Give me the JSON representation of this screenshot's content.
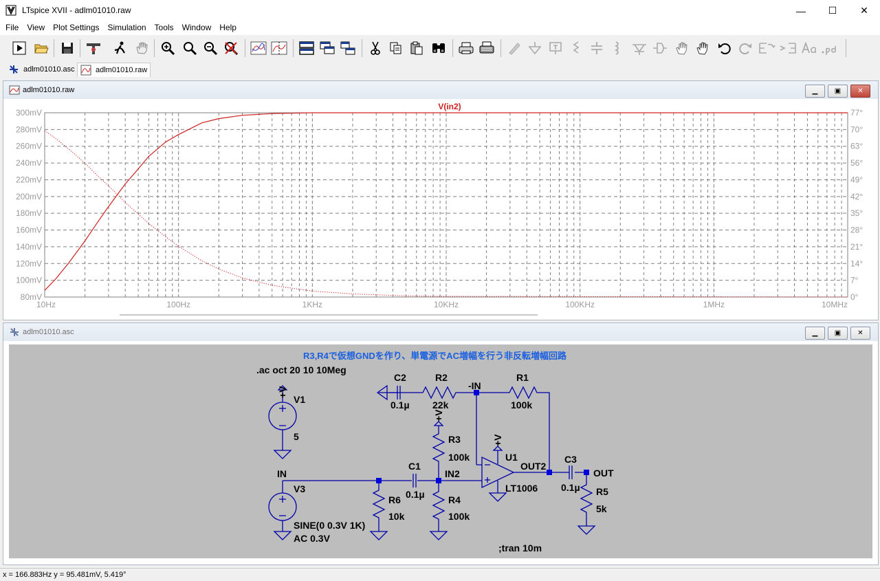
{
  "window": {
    "title": "LTspice XVII - adlm01010.raw",
    "min_label": "—",
    "max_label": "☐",
    "close_label": "✕"
  },
  "menu": {
    "items": [
      "File",
      "View",
      "Plot Settings",
      "Simulation",
      "Tools",
      "Window",
      "Help"
    ]
  },
  "toolbar": {
    "icons": [
      "run-icon",
      "open-icon",
      "save-icon",
      "control-panel-icon",
      "run-animate-icon",
      "pan-hand-icon",
      "zoom-in-icon",
      "zoom-out-icon",
      "zoom-fit-icon",
      "zoom-cancel-icon",
      "autorange-icon",
      "plot-pane-icon",
      "tile-horizontal-icon",
      "cascade-icon",
      "tile-vertical-icon",
      "cut-icon",
      "copy-icon",
      "paste-icon",
      "find-icon",
      "print-icon",
      "print-setup-icon",
      "draw-wire-icon",
      "ground-icon",
      "label-net-icon",
      "resistor-icon",
      "capacitor-icon",
      "inductor-icon",
      "diode-icon",
      "component-icon",
      "move-icon",
      "drag-icon",
      "undo-icon",
      "redo-icon",
      "rotate-icon",
      "mirror-icon",
      "text-icon",
      "spice-directive-icon"
    ]
  },
  "tabs": [
    {
      "label": "adlm01010.asc",
      "icon": "schematic-tab-icon"
    },
    {
      "label": "adlm01010.raw",
      "icon": "waveform-tab-icon"
    }
  ],
  "plot_window": {
    "title": "adlm01010.raw",
    "trace_name": "V(in2)",
    "trace_color": "#d02020",
    "grid_color": "#808080"
  },
  "chart_data": {
    "type": "line",
    "x_scale": "log",
    "xlim": [
      10,
      10000000
    ],
    "xtick_labels": [
      "10Hz",
      "100Hz",
      "1KHz",
      "10KHz",
      "100KHz",
      "1MHz",
      "10MHz"
    ],
    "ylim": [
      80,
      300
    ],
    "ytick_labels": [
      "80mV",
      "100mV",
      "120mV",
      "140mV",
      "160mV",
      "180mV",
      "200mV",
      "220mV",
      "240mV",
      "260mV",
      "280mV",
      "300mV"
    ],
    "y2lim": [
      0,
      77
    ],
    "y2tick_labels": [
      "0°",
      "7°",
      "14°",
      "21°",
      "28°",
      "35°",
      "42°",
      "49°",
      "56°",
      "63°",
      "70°",
      "77°"
    ],
    "grid": true,
    "series": [
      {
        "name": "V(in2)",
        "axis": "left",
        "style": "solid",
        "x": [
          10,
          12,
          15,
          20,
          25,
          30,
          40,
          50,
          60,
          80,
          100,
          150,
          200,
          300,
          500,
          1000,
          10000000
        ],
        "y": [
          88,
          101,
          120,
          147,
          170,
          188,
          215,
          233,
          248,
          265,
          274,
          288,
          293,
          297,
          299,
          300,
          300
        ]
      },
      {
        "name": "V(in2) phase",
        "axis": "right",
        "style": "dotted",
        "x": [
          10,
          12,
          15,
          20,
          25,
          30,
          40,
          50,
          60,
          80,
          100,
          150,
          200,
          300,
          500,
          1000,
          2000,
          5000,
          10000,
          10000000
        ],
        "y": [
          69.5,
          66.4,
          62,
          56,
          50.5,
          46.5,
          39.5,
          34.7,
          30.7,
          25.2,
          21.2,
          15.1,
          11.7,
          8,
          4.9,
          2.5,
          1.3,
          0.5,
          0.3,
          0
        ]
      }
    ]
  },
  "schematic_window": {
    "title": "adlm01010.asc",
    "comment": "R3,R4で仮想GNDを作り、単電源でAC増幅を行う非反転増幅回路",
    "ac_directive": ".ac oct 20 10 10Meg",
    "tran_directive": ";tran 10m",
    "labels": {
      "V1": "V1",
      "V1_val": "5",
      "V3": "V3",
      "V3_val1": "SINE(0 0.3V 1K)",
      "V3_val2": "AC 0.3V",
      "C1": "C1",
      "C1_val": "0.1µ",
      "C2": "C2",
      "C2_val": "0.1µ",
      "C3": "C3",
      "C3_val": "0.1µ",
      "R1": "R1",
      "R1_val": "100k",
      "R2": "R2",
      "R2_val": "22k",
      "R3": "R3",
      "R3_val": "100k",
      "R4": "R4",
      "R4_val": "100k",
      "R5": "R5",
      "R5_val": "5k",
      "R6": "R6",
      "R6_val": "10k",
      "U1": "U1",
      "U1_val": "LT1006",
      "net_in": "IN",
      "net_in2": "IN2",
      "net_minus_in": "-IN",
      "net_out2": "OUT2",
      "net_out": "OUT",
      "vplus": "+V"
    }
  },
  "status": {
    "cursor": "x = 166.883Hz    y = 95.481mV, 5.419°"
  }
}
